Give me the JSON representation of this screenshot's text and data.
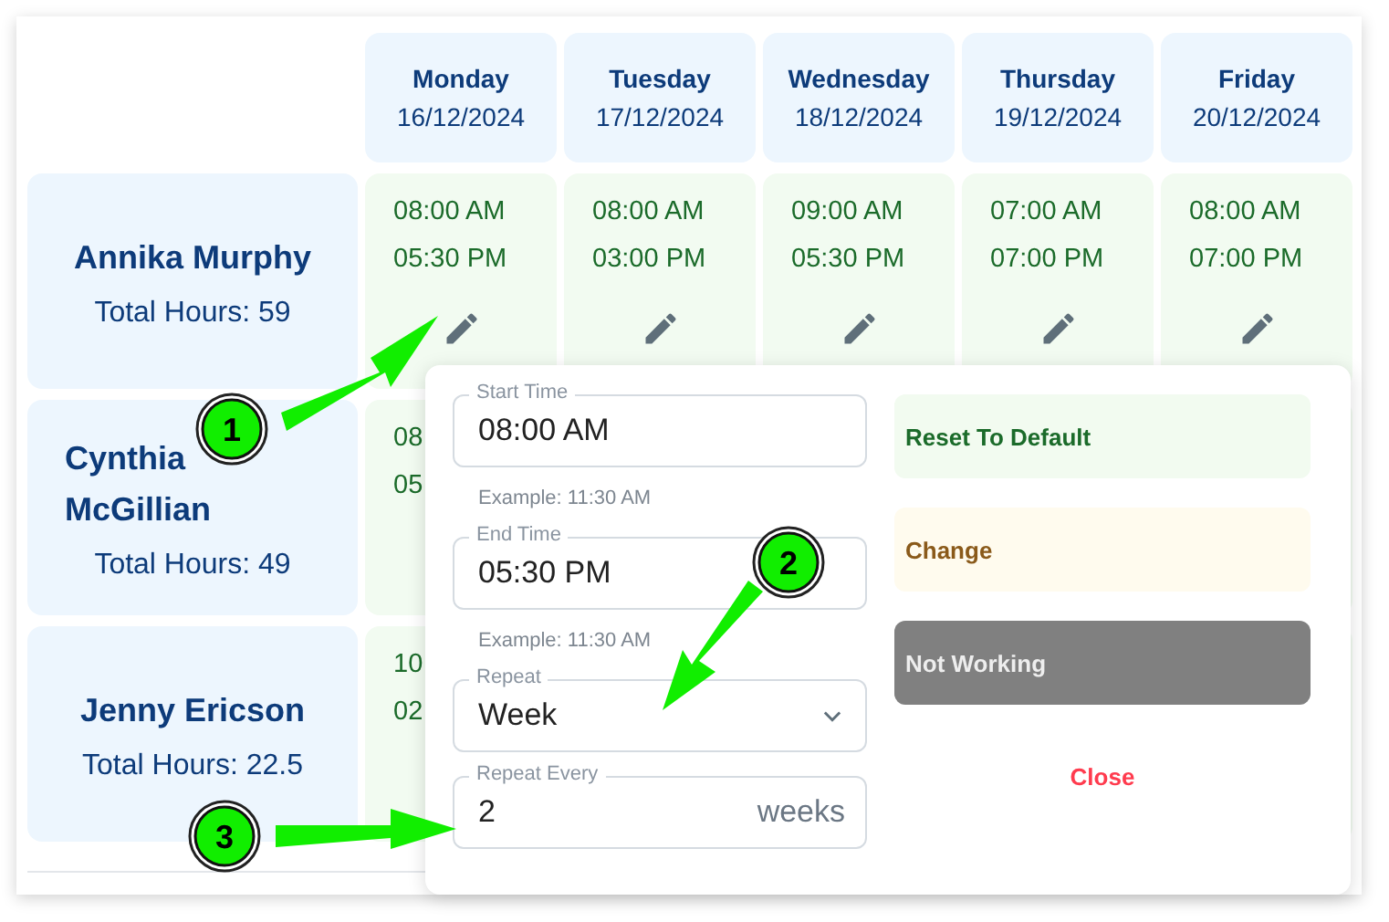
{
  "days": [
    {
      "day": "Monday",
      "date": "16/12/2024"
    },
    {
      "day": "Tuesday",
      "date": "17/12/2024"
    },
    {
      "day": "Wednesday",
      "date": "18/12/2024"
    },
    {
      "day": "Thursday",
      "date": "19/12/2024"
    },
    {
      "day": "Friday",
      "date": "20/12/2024"
    }
  ],
  "employees": [
    {
      "name": "Annika Murphy",
      "total_hours": "Total Hours: 59",
      "shifts": [
        {
          "times": [
            "08:00 AM",
            "05:30 PM"
          ],
          "edit": true
        },
        {
          "times": [
            "08:00 AM",
            "03:00 PM"
          ],
          "edit": true
        },
        {
          "times": [
            "09:00 AM",
            "05:30 PM"
          ],
          "edit": true
        },
        {
          "times": [
            "07:00 AM",
            "07:00 PM"
          ],
          "edit": true
        },
        {
          "times": [
            "08:00 AM",
            "07:00 PM"
          ],
          "edit": true
        }
      ]
    },
    {
      "name": "Cynthia McGillian",
      "total_hours": "Total Hours: 49",
      "shifts": [
        {
          "times": [
            "08",
            "05"
          ]
        }
      ]
    },
    {
      "name": "Jenny Ericson",
      "total_hours": "Total Hours: 22.5",
      "shifts": [
        {
          "times": [
            "10",
            "02"
          ]
        }
      ]
    }
  ],
  "editor": {
    "fields": [
      {
        "kind": "text",
        "label": "Start Time",
        "value": "08:00 AM",
        "helper": "Example: 11:30 AM"
      },
      {
        "kind": "text",
        "label": "End Time",
        "value": "05:30 PM",
        "helper": "Example: 11:30 AM"
      },
      {
        "kind": "select",
        "label": "Repeat",
        "value": "Week"
      },
      {
        "kind": "number",
        "label": "Repeat Every",
        "value": "2",
        "unit": "weeks"
      }
    ],
    "actions": [
      {
        "kind": "reset",
        "label": "Reset To Default"
      },
      {
        "kind": "change",
        "label": "Change"
      },
      {
        "kind": "off",
        "label": "Not Working"
      },
      {
        "kind": "close",
        "label": "Close"
      }
    ]
  },
  "callouts": [
    {
      "label": "1"
    },
    {
      "label": "2"
    },
    {
      "label": "3"
    }
  ]
}
